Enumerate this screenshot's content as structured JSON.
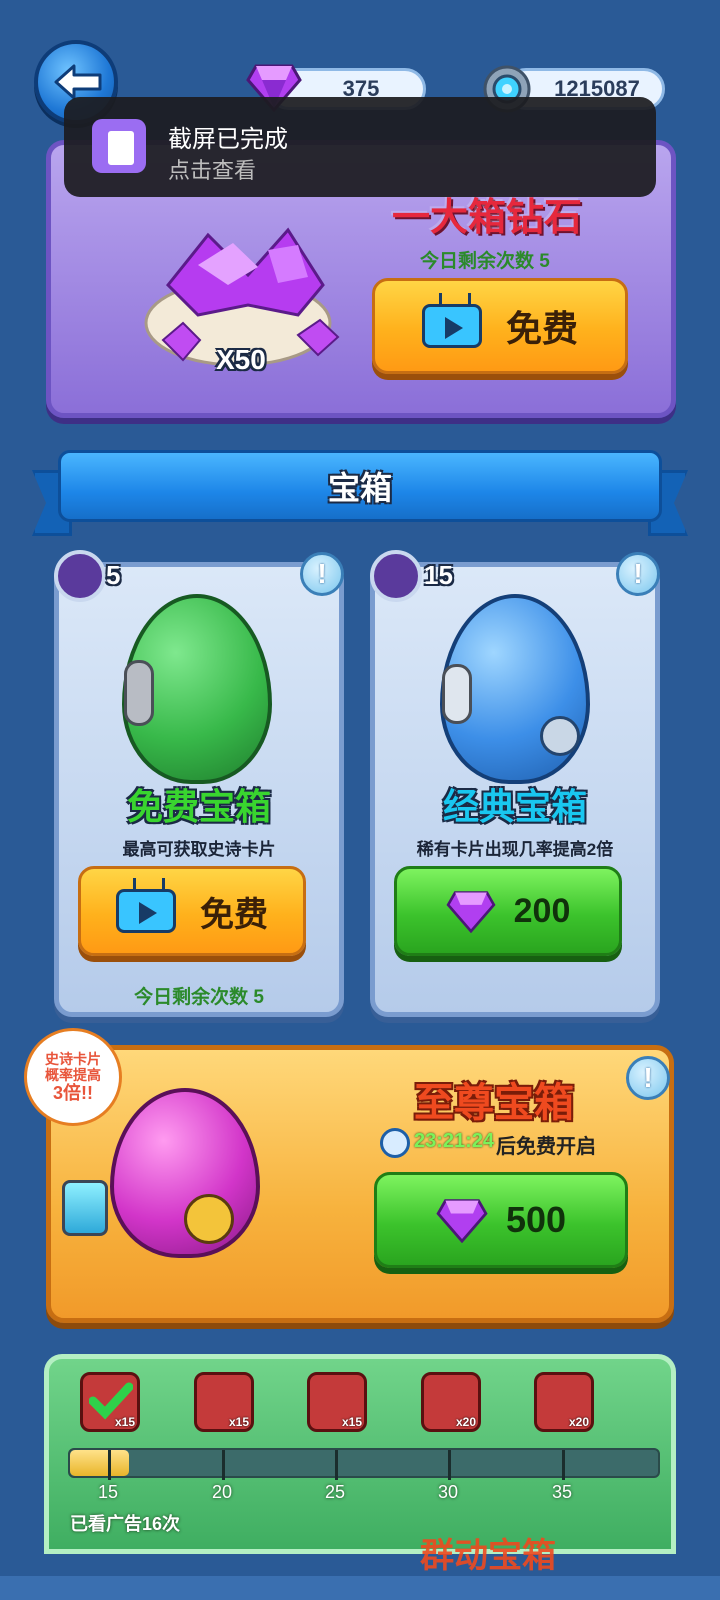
{
  "top_bar": {
    "gems": "375",
    "coins": "1215087"
  },
  "toast": {
    "title": "截屏已完成",
    "subtitle": "点击查看"
  },
  "diamond_box": {
    "title": "一大箱钻石",
    "remaining": "今日剩余次数  5",
    "multiplier": "X50",
    "button_label": "免费"
  },
  "section_banner": "宝箱",
  "chests": [
    {
      "badge_count": "5",
      "title": "免费宝箱",
      "title_color": "#39d52f",
      "desc": "最高可获取史诗卡片",
      "button_label": "免费",
      "remaining": "今日剩余次数  5",
      "egg_color": "#38b94a"
    },
    {
      "badge_count": "15",
      "title": "经典宝箱",
      "title_color": "#19c7f0",
      "desc": "稀有卡片出现几率提高2倍",
      "button_value": "200",
      "egg_color": "#3d8fe8"
    }
  ],
  "supreme_chest": {
    "title": "至尊宝箱",
    "timer": "23:21:24",
    "timer_suffix": "后免费开启",
    "button_value": "500",
    "badge_line1": "史诗卡片",
    "badge_line2": "概率提高",
    "badge_line3": "3倍!!"
  },
  "ad_track": {
    "rewards": [
      "x15",
      "x15",
      "x15",
      "x20",
      "x20"
    ],
    "milestones": [
      "15",
      "20",
      "25",
      "30",
      "35"
    ],
    "progress": 0.1,
    "watched": "已看广告16次",
    "next_title": "群动宝箱"
  },
  "icons": {
    "back": "back-arrow-icon",
    "gem": "purple-gem-icon",
    "coin": "gear-coin-icon",
    "tv": "video-ad-icon",
    "info": "info-icon",
    "clock": "clock-icon"
  }
}
